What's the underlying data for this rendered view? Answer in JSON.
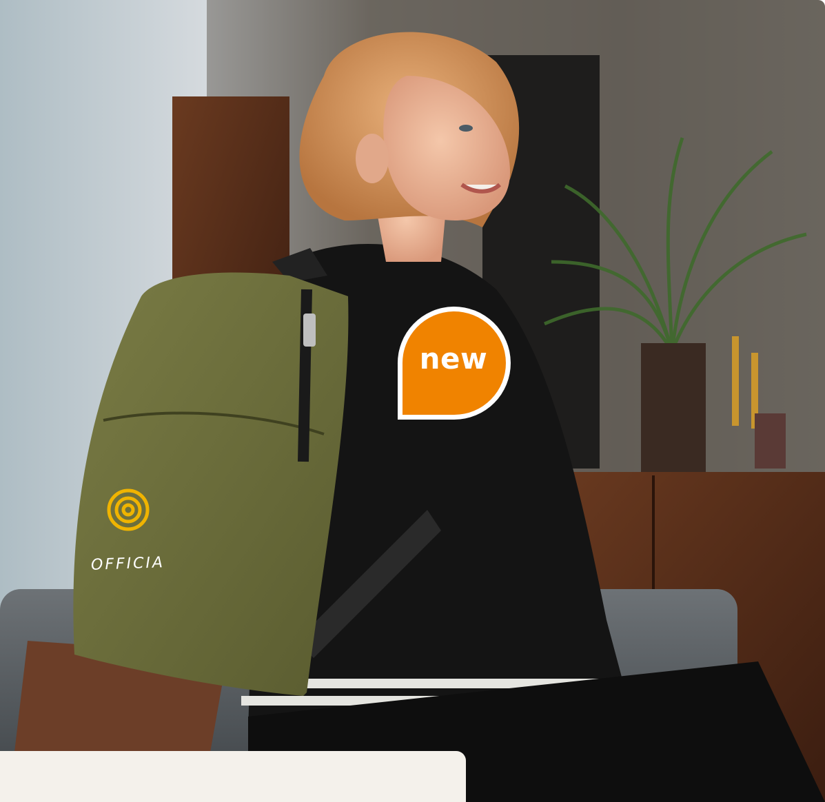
{
  "badge": {
    "label": "new",
    "color": "#f08300",
    "border_color": "#ffffff"
  },
  "product": {
    "brand_text": "OFFICIA",
    "logo_color": "#f0b400",
    "bag_color": "#6b6d3a"
  },
  "caption_card": {
    "background": "#f4f1eb"
  }
}
